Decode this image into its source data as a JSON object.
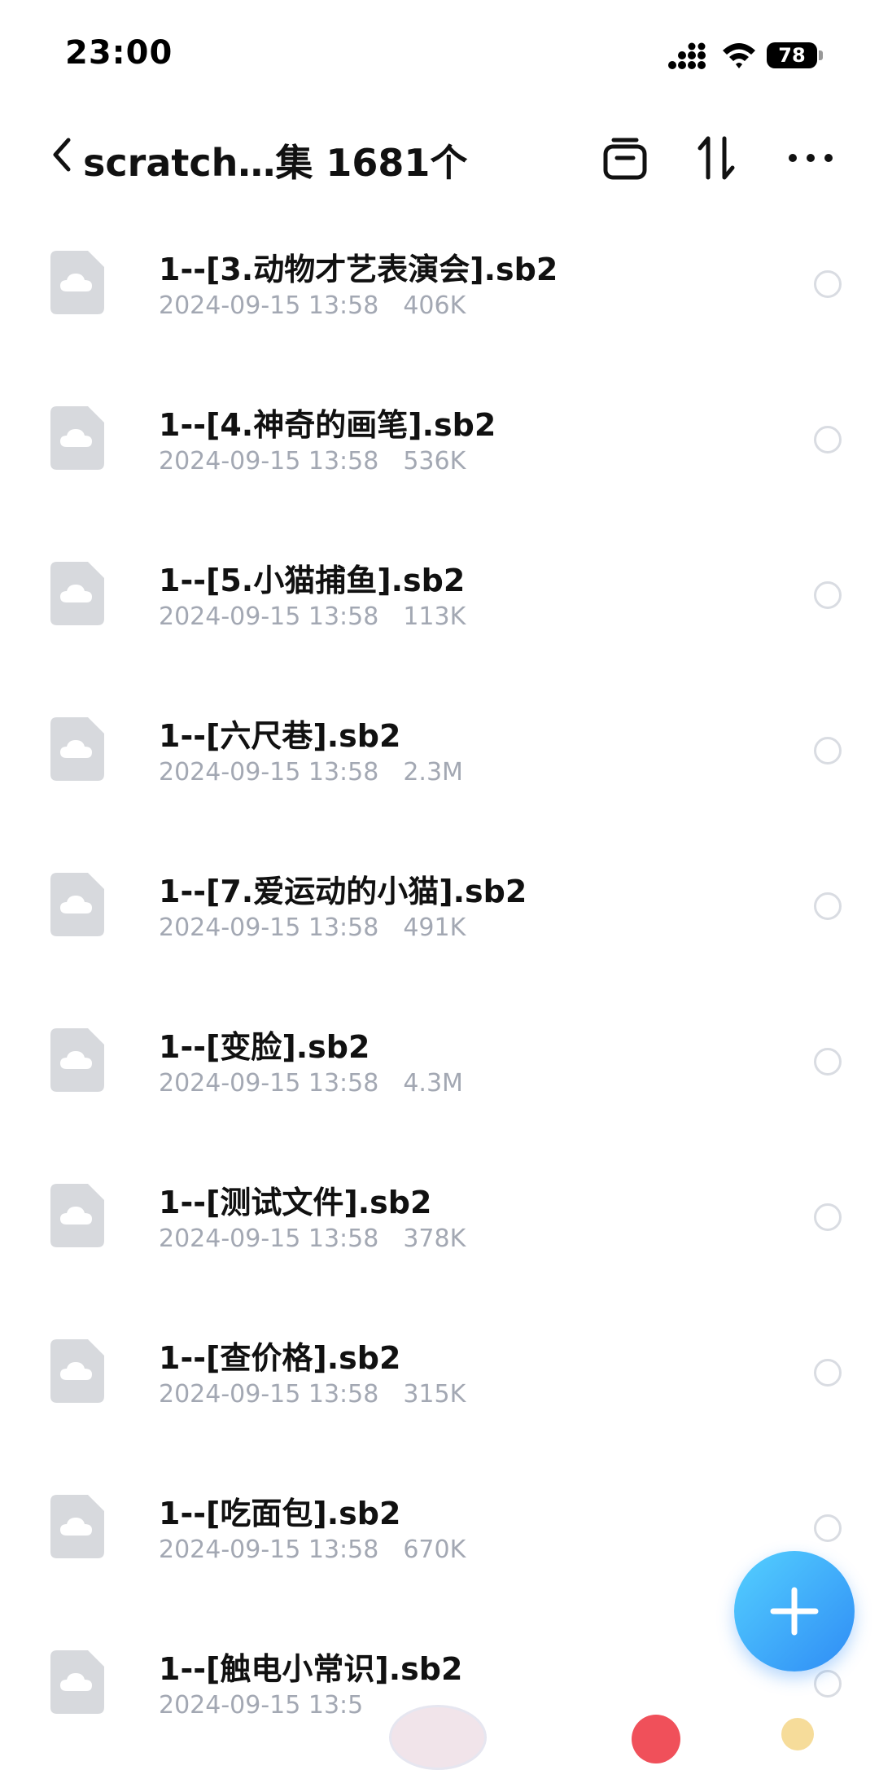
{
  "status_bar": {
    "time": "23:00",
    "battery_level": "78",
    "icons": [
      "signal-icon",
      "wifi-icon",
      "battery-icon"
    ]
  },
  "nav": {
    "title": "scratch…集 1681个",
    "icons": [
      "back-icon",
      "multi-select-icon",
      "sort-icon",
      "more-icon"
    ]
  },
  "files": [
    {
      "name": "1--[3.动物才艺表演会].sb2",
      "date": "2024-09-15 13:58",
      "size": "406K"
    },
    {
      "name": "1--[4.神奇的画笔].sb2",
      "date": "2024-09-15 13:58",
      "size": "536K"
    },
    {
      "name": "1--[5.小猫捕鱼].sb2",
      "date": "2024-09-15 13:58",
      "size": "113K"
    },
    {
      "name": "1--[六尺巷].sb2",
      "date": "2024-09-15 13:58",
      "size": "2.3M"
    },
    {
      "name": "1--[7.爱运动的小猫].sb2",
      "date": "2024-09-15 13:58",
      "size": "491K"
    },
    {
      "name": "1--[变脸].sb2",
      "date": "2024-09-15 13:58",
      "size": "4.3M"
    },
    {
      "name": "1--[测试文件].sb2",
      "date": "2024-09-15 13:58",
      "size": "378K"
    },
    {
      "name": "1--[查价格].sb2",
      "date": "2024-09-15 13:58",
      "size": "315K"
    },
    {
      "name": "1--[吃面包].sb2",
      "date": "2024-09-15 13:58",
      "size": "670K"
    },
    {
      "name": "1--[触电小常识].sb2",
      "date": "2024-09-15 13:5",
      "size": ""
    }
  ],
  "colors": {
    "accent": "#2f8cf5",
    "accent_light": "#54d0ff",
    "meta_text": "#a3a8b3",
    "file_icon": "#d7d9dd"
  },
  "fab": {
    "icon": "plus-icon"
  }
}
